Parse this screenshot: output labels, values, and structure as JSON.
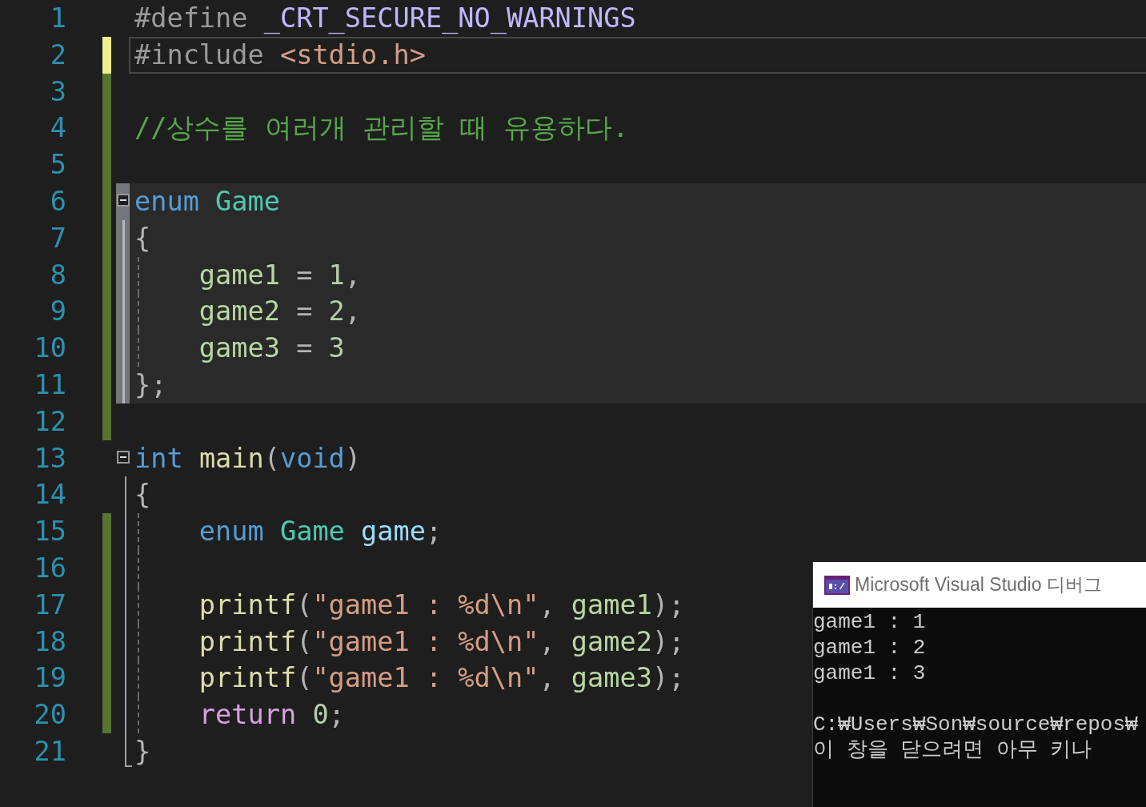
{
  "editor": {
    "lines": [
      {
        "number": "1",
        "current": false,
        "scope": false,
        "guide": false,
        "tokens": [
          {
            "text": "#define ",
            "kind": "preproc"
          },
          {
            "text": "_CRT_SECURE_NO_WARNINGS",
            "kind": "macro"
          }
        ]
      },
      {
        "number": "2",
        "marker": {
          "saved": false
        },
        "current": true,
        "scope": false,
        "guide": false,
        "tokens": [
          {
            "text": "#include ",
            "kind": "preproc"
          },
          {
            "text": "<stdio.h>",
            "kind": "include"
          }
        ]
      },
      {
        "number": "3",
        "marker": {
          "saved": true
        },
        "current": false,
        "scope": false,
        "guide": false
      },
      {
        "number": "4",
        "marker": {
          "saved": true
        },
        "current": false,
        "scope": false,
        "guide": false,
        "tokens": [
          {
            "text": "//상수를 여러개 관리할 때 유용하다.",
            "kind": "comment"
          }
        ]
      },
      {
        "number": "5",
        "marker": {
          "saved": true
        },
        "current": false,
        "scope": false,
        "guide": false
      },
      {
        "number": "6",
        "marker": {
          "saved": true
        },
        "outline": {
          "kind": "start"
        },
        "current": false,
        "scope": true,
        "guide": false,
        "tokens": [
          {
            "text": "enum ",
            "kind": "keyword"
          },
          {
            "text": "Game",
            "kind": "type"
          }
        ]
      },
      {
        "number": "7",
        "marker": {
          "saved": true
        },
        "outline": {
          "kind": "body"
        },
        "current": false,
        "scope": true,
        "guide": false,
        "tokens": [
          {
            "text": "{",
            "kind": "punct"
          }
        ]
      },
      {
        "number": "8",
        "marker": {
          "saved": true
        },
        "outline": {
          "kind": "body"
        },
        "current": false,
        "scope": true,
        "guide": true,
        "tokens": [
          {
            "text": "    game1",
            "kind": "enumconst"
          },
          {
            "text": " = ",
            "kind": "punct"
          },
          {
            "text": "1",
            "kind": "number"
          },
          {
            "text": ",",
            "kind": "punct"
          }
        ]
      },
      {
        "number": "9",
        "marker": {
          "saved": true
        },
        "outline": {
          "kind": "body"
        },
        "current": false,
        "scope": true,
        "guide": true,
        "tokens": [
          {
            "text": "    game2",
            "kind": "enumconst"
          },
          {
            "text": " = ",
            "kind": "punct"
          },
          {
            "text": "2",
            "kind": "number"
          },
          {
            "text": ",",
            "kind": "punct"
          }
        ]
      },
      {
        "number": "10",
        "marker": {
          "saved": true
        },
        "outline": {
          "kind": "body"
        },
        "current": false,
        "scope": true,
        "guide": true,
        "tokens": [
          {
            "text": "    game3",
            "kind": "enumconst"
          },
          {
            "text": " = ",
            "kind": "punct"
          },
          {
            "text": "3",
            "kind": "number"
          }
        ]
      },
      {
        "number": "11",
        "marker": {
          "saved": true
        },
        "outline": {
          "kind": "body"
        },
        "current": false,
        "scope": true,
        "guide": false,
        "tokens": [
          {
            "text": "};",
            "kind": "punct"
          }
        ]
      },
      {
        "number": "12",
        "marker": {
          "saved": true
        },
        "current": false,
        "scope": false,
        "guide": false
      },
      {
        "number": "13",
        "outline": {
          "kind": "start"
        },
        "current": false,
        "scope": false,
        "guide": false,
        "tokens": [
          {
            "text": "int ",
            "kind": "keyword"
          },
          {
            "text": "main",
            "kind": "func"
          },
          {
            "text": "(",
            "kind": "punct"
          },
          {
            "text": "void",
            "kind": "keyword"
          },
          {
            "text": ")",
            "kind": "punct"
          }
        ]
      },
      {
        "number": "14",
        "outline": {
          "kind": "body"
        },
        "current": false,
        "scope": false,
        "guide": false,
        "tokens": [
          {
            "text": "{",
            "kind": "punct"
          }
        ]
      },
      {
        "number": "15",
        "marker": {
          "saved": true
        },
        "outline": {
          "kind": "body"
        },
        "current": false,
        "scope": false,
        "guide": true,
        "tokens": [
          {
            "text": "    enum ",
            "kind": "keyword"
          },
          {
            "text": "Game ",
            "kind": "type"
          },
          {
            "text": "game",
            "kind": "local"
          },
          {
            "text": ";",
            "kind": "punct"
          }
        ]
      },
      {
        "number": "16",
        "marker": {
          "saved": true
        },
        "outline": {
          "kind": "body"
        },
        "current": false,
        "scope": false,
        "guide": true
      },
      {
        "number": "17",
        "marker": {
          "saved": true
        },
        "outline": {
          "kind": "body"
        },
        "current": false,
        "scope": false,
        "guide": true,
        "tokens": [
          {
            "text": "    printf",
            "kind": "func"
          },
          {
            "text": "(",
            "kind": "punct"
          },
          {
            "text": "\"game1 : %d\\n\"",
            "kind": "string"
          },
          {
            "text": ", ",
            "kind": "punct"
          },
          {
            "text": "game1",
            "kind": "enumconst"
          },
          {
            "text": ");",
            "kind": "punct"
          }
        ]
      },
      {
        "number": "18",
        "marker": {
          "saved": true
        },
        "outline": {
          "kind": "body"
        },
        "current": false,
        "scope": false,
        "guide": true,
        "tokens": [
          {
            "text": "    printf",
            "kind": "func"
          },
          {
            "text": "(",
            "kind": "punct"
          },
          {
            "text": "\"game1 : %d\\n\"",
            "kind": "string"
          },
          {
            "text": ", ",
            "kind": "punct"
          },
          {
            "text": "game2",
            "kind": "enumconst"
          },
          {
            "text": ");",
            "kind": "punct"
          }
        ]
      },
      {
        "number": "19",
        "marker": {
          "saved": true
        },
        "outline": {
          "kind": "body"
        },
        "current": false,
        "scope": false,
        "guide": true,
        "tokens": [
          {
            "text": "    printf",
            "kind": "func"
          },
          {
            "text": "(",
            "kind": "punct"
          },
          {
            "text": "\"game1 : %d\\n\"",
            "kind": "string"
          },
          {
            "text": ", ",
            "kind": "punct"
          },
          {
            "text": "game3",
            "kind": "enumconst"
          },
          {
            "text": ");",
            "kind": "punct"
          }
        ]
      },
      {
        "number": "20",
        "marker": {
          "saved": true
        },
        "outline": {
          "kind": "body"
        },
        "current": false,
        "scope": false,
        "guide": true,
        "tokens": [
          {
            "text": "    return ",
            "kind": "control"
          },
          {
            "text": "0",
            "kind": "number"
          },
          {
            "text": ";",
            "kind": "punct"
          }
        ]
      },
      {
        "number": "21",
        "outline": {
          "kind": "end"
        },
        "current": false,
        "scope": false,
        "guide": false,
        "tokens": [
          {
            "text": "}",
            "kind": "punct"
          }
        ]
      }
    ]
  },
  "console": {
    "title": "Microsoft Visual Studio 디버그",
    "output": [
      "game1 : 1",
      "game1 : 2",
      "game1 : 3"
    ],
    "prompt": [
      "C:₩Users₩Son₩source₩repos₩",
      "이 창을 닫으려면 아무 키나"
    ]
  }
}
